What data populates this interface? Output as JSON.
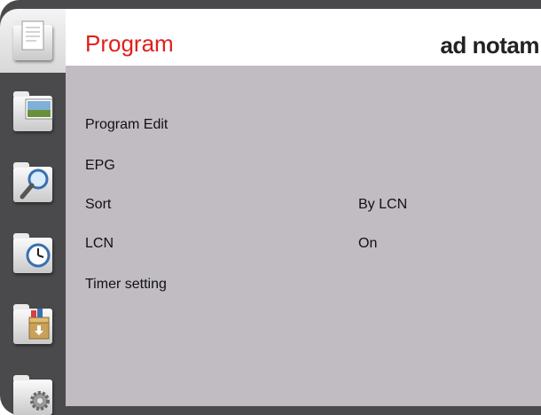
{
  "header": {
    "title": "Program",
    "brand": "ad notam"
  },
  "sidebar": {
    "items": [
      {
        "icon": "document-folder-icon",
        "active": true
      },
      {
        "icon": "picture-folder-icon",
        "active": false
      },
      {
        "icon": "search-folder-icon",
        "active": false
      },
      {
        "icon": "clock-folder-icon",
        "active": false
      },
      {
        "icon": "box-folder-icon",
        "active": false
      },
      {
        "icon": "gear-folder-icon",
        "active": false
      }
    ]
  },
  "menu": {
    "items": [
      {
        "label": "Program Edit",
        "value": ""
      },
      {
        "label": "EPG",
        "value": ""
      },
      {
        "label": "Sort",
        "value": "By LCN"
      },
      {
        "label": "LCN",
        "value": "On"
      },
      {
        "label": "Timer setting",
        "value": ""
      }
    ]
  },
  "colors": {
    "frame": "#4a4a4c",
    "panel": "#c0bcc2",
    "title": "#e0201c"
  }
}
